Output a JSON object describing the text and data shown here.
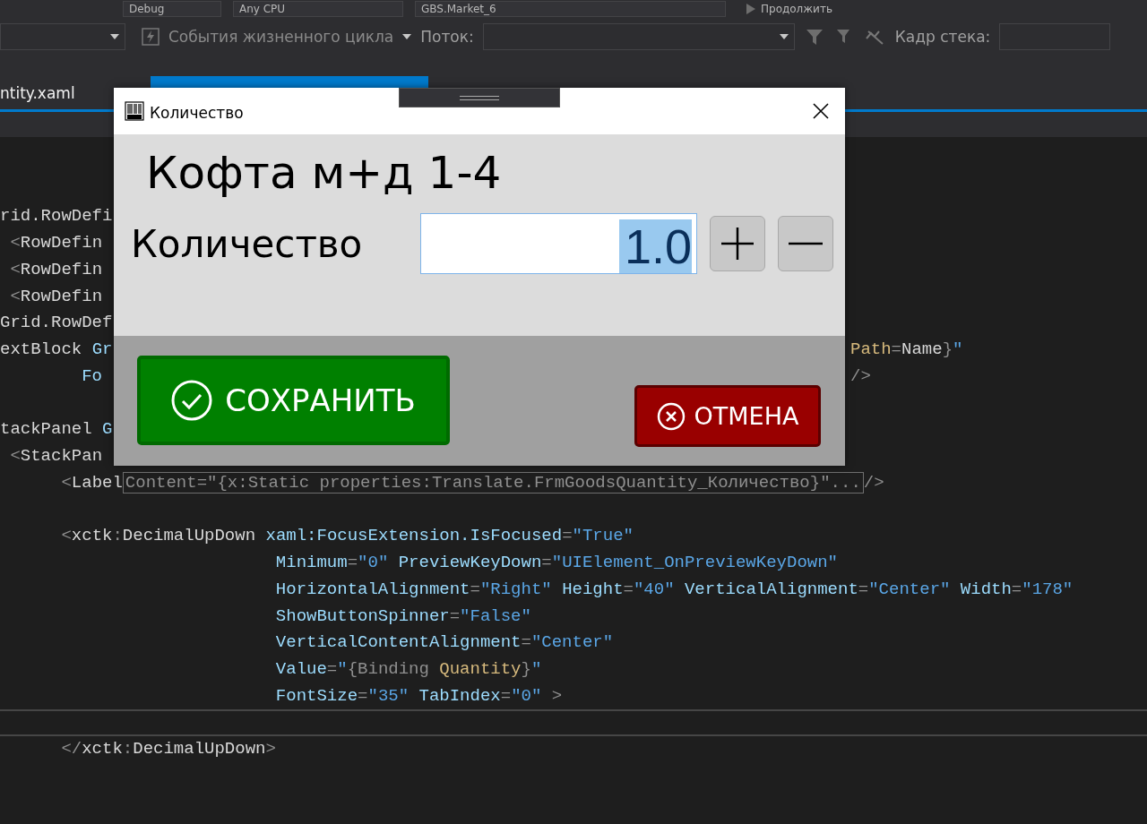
{
  "toolbar": {
    "configuration": "Debug",
    "platform": "Any CPU",
    "startup_project": "GBS.Market_6",
    "continue_button": "Продолжить"
  },
  "debug_toolbar": {
    "lifecycle_events": "События жизненного цикла",
    "thread_label": "Поток:",
    "stack_frame_label": "Кадр стека:"
  },
  "tabs": [
    {
      "label": "ntity.xaml",
      "selected": false
    },
    {
      "selected": true
    }
  ],
  "editor": {
    "lines": [
      {
        "kind": "blank"
      },
      {
        "kind": "blank"
      },
      {
        "kind": "split",
        "tokens": [
          {
            "kind": "tag",
            "text": "rid.RowDefi"
          }
        ]
      },
      {
        "kind": "split",
        "tokens": [
          {
            "kind": "punct",
            "text": " <"
          },
          {
            "kind": "tag",
            "text": "RowDefin"
          }
        ]
      },
      {
        "kind": "split",
        "tokens": [
          {
            "kind": "punct",
            "text": " <"
          },
          {
            "kind": "tag",
            "text": "RowDefin"
          }
        ]
      },
      {
        "kind": "split",
        "tokens": [
          {
            "kind": "punct",
            "text": " <"
          },
          {
            "kind": "tag",
            "text": "RowDefin"
          }
        ]
      },
      {
        "kind": "split",
        "tokens": [
          {
            "kind": "tag",
            "text": "Grid.RowDef"
          }
        ]
      },
      {
        "kind": "split",
        "tokens": [
          {
            "kind": "tag",
            "text": "extBlock "
          },
          {
            "kind": "attr",
            "text": "Gr"
          }
        ],
        "right": [
          {
            "kind": "binding",
            "text": "Path"
          },
          {
            "kind": "punct",
            "text": "="
          },
          {
            "kind": "tag",
            "text": "Name"
          },
          {
            "kind": "punct",
            "text": "}"
          },
          {
            "kind": "value",
            "text": "\""
          }
        ]
      },
      {
        "kind": "split",
        "tokens": [
          {
            "kind": "attr",
            "text": "        Fo"
          }
        ],
        "right": [
          {
            "kind": "punct",
            "text": "/>"
          }
        ]
      },
      {
        "kind": "blank"
      },
      {
        "kind": "split",
        "tokens": [
          {
            "kind": "tag",
            "text": "tackPanel "
          },
          {
            "kind": "attr",
            "text": "G"
          }
        ]
      },
      {
        "kind": "split",
        "tokens": [
          {
            "kind": "punct",
            "text": " <"
          },
          {
            "kind": "tag",
            "text": "StackPan"
          }
        ]
      },
      {
        "kind": "code",
        "tokens": [
          {
            "kind": "punct",
            "text": "      <"
          },
          {
            "kind": "tag",
            "text": "Label"
          },
          {
            "kind": "collapsed",
            "text": "Content=\"{x:Static properties:Translate.FrmGoodsQuantity_Количество}\"..."
          },
          {
            "kind": "punct",
            "text": "/>"
          }
        ]
      },
      {
        "kind": "blank"
      },
      {
        "kind": "code",
        "tokens": [
          {
            "kind": "punct",
            "text": "      <"
          },
          {
            "kind": "tag",
            "text": "xctk"
          },
          {
            "kind": "punct",
            "text": ":"
          },
          {
            "kind": "tag",
            "text": "DecimalUpDown "
          },
          {
            "kind": "attr",
            "text": "xaml:FocusExtension.IsFocused"
          },
          {
            "kind": "punct",
            "text": "="
          },
          {
            "kind": "value",
            "text": "\"True\""
          }
        ]
      },
      {
        "kind": "code",
        "tokens": [
          {
            "kind": "attr",
            "text": "                           Minimum"
          },
          {
            "kind": "punct",
            "text": "="
          },
          {
            "kind": "value",
            "text": "\"0\" "
          },
          {
            "kind": "attr",
            "text": "PreviewKeyDown"
          },
          {
            "kind": "punct",
            "text": "="
          },
          {
            "kind": "value",
            "text": "\"UIElement_OnPreviewKeyDown\""
          }
        ]
      },
      {
        "kind": "code",
        "tokens": [
          {
            "kind": "attr",
            "text": "                           HorizontalAlignment"
          },
          {
            "kind": "punct",
            "text": "="
          },
          {
            "kind": "value",
            "text": "\"Right\" "
          },
          {
            "kind": "attr",
            "text": "Height"
          },
          {
            "kind": "punct",
            "text": "="
          },
          {
            "kind": "value",
            "text": "\"40\" "
          },
          {
            "kind": "attr",
            "text": "VerticalAlignment"
          },
          {
            "kind": "punct",
            "text": "="
          },
          {
            "kind": "value",
            "text": "\"Center\" "
          },
          {
            "kind": "attr",
            "text": "Width"
          },
          {
            "kind": "punct",
            "text": "="
          },
          {
            "kind": "value",
            "text": "\"178\""
          }
        ]
      },
      {
        "kind": "code",
        "tokens": [
          {
            "kind": "attr",
            "text": "                           ShowButtonSpinner"
          },
          {
            "kind": "punct",
            "text": "="
          },
          {
            "kind": "value",
            "text": "\"False\""
          }
        ]
      },
      {
        "kind": "code",
        "tokens": [
          {
            "kind": "attr",
            "text": "                           VerticalContentAlignment"
          },
          {
            "kind": "punct",
            "text": "="
          },
          {
            "kind": "value",
            "text": "\"Center\""
          }
        ]
      },
      {
        "kind": "code",
        "tokens": [
          {
            "kind": "attr",
            "text": "                           Value"
          },
          {
            "kind": "punct",
            "text": "="
          },
          {
            "kind": "value",
            "text": "\""
          },
          {
            "kind": "punct",
            "text": "{Binding "
          },
          {
            "kind": "binding",
            "text": "Quantity"
          },
          {
            "kind": "punct",
            "text": "}"
          },
          {
            "kind": "value",
            "text": "\""
          }
        ]
      },
      {
        "kind": "code",
        "tokens": [
          {
            "kind": "attr",
            "text": "                           FontSize"
          },
          {
            "kind": "punct",
            "text": "="
          },
          {
            "kind": "value",
            "text": "\"35\" "
          },
          {
            "kind": "attr",
            "text": "TabIndex"
          },
          {
            "kind": "punct",
            "text": "="
          },
          {
            "kind": "value",
            "text": "\"0\" "
          },
          {
            "kind": "punct",
            "text": ">"
          }
        ]
      },
      {
        "kind": "current"
      },
      {
        "kind": "code",
        "tokens": [
          {
            "kind": "punct",
            "text": "      </"
          },
          {
            "kind": "tag",
            "text": "xctk"
          },
          {
            "kind": "punct",
            "text": ":"
          },
          {
            "kind": "tag",
            "text": "DecimalUpDown"
          },
          {
            "kind": "punct",
            "text": ">"
          }
        ]
      }
    ]
  },
  "dialog": {
    "title": "Количество",
    "product_name": "Кофта м+д 1-4",
    "quantity_label": "Количество",
    "quantity": {
      "value": "1.0",
      "value_selected": true
    },
    "save_button": "СОХРАНИТЬ",
    "cancel_button": "ОТМЕНА"
  }
}
